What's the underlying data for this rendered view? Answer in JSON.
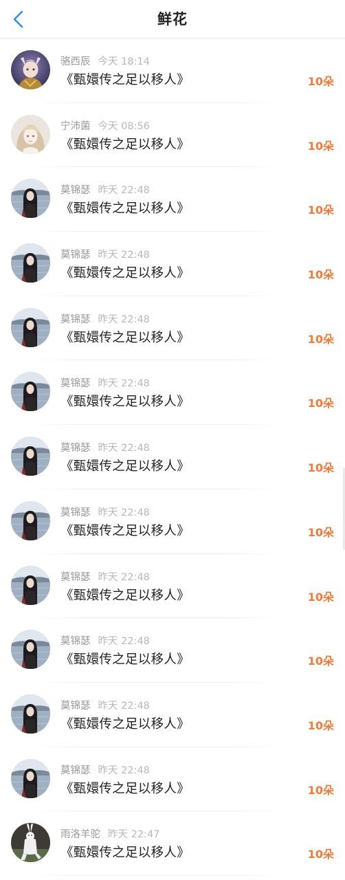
{
  "header": {
    "title": "鲜花",
    "back_icon": "chevron-left-icon",
    "accent_color": "#2b8ef0"
  },
  "colors": {
    "amount": "#f07c3b",
    "name": "#999999",
    "time": "#b8b8b8",
    "book": "#222222"
  },
  "items": [
    {
      "name": "骆西辰",
      "time": "今天 18:14",
      "book": "《甄嬛传之足以移人》",
      "amount": "10朵",
      "avatar": "anime-warrior-avatar"
    },
    {
      "name": "宁沛菌",
      "time": "今天 08:56",
      "book": "《甄嬛传之足以移人》",
      "amount": "10朵",
      "avatar": "anime-girl-avatar"
    },
    {
      "name": "莫锦瑟",
      "time": "昨天 22:48",
      "book": "《甄嬛传之足以移人》",
      "amount": "10朵",
      "avatar": "lake-girl-avatar"
    },
    {
      "name": "莫锦瑟",
      "time": "昨天 22:48",
      "book": "《甄嬛传之足以移人》",
      "amount": "10朵",
      "avatar": "lake-girl-avatar"
    },
    {
      "name": "莫锦瑟",
      "time": "昨天 22:48",
      "book": "《甄嬛传之足以移人》",
      "amount": "10朵",
      "avatar": "lake-girl-avatar"
    },
    {
      "name": "莫锦瑟",
      "time": "昨天 22:48",
      "book": "《甄嬛传之足以移人》",
      "amount": "10朵",
      "avatar": "lake-girl-avatar"
    },
    {
      "name": "莫锦瑟",
      "time": "昨天 22:48",
      "book": "《甄嬛传之足以移人》",
      "amount": "10朵",
      "avatar": "lake-girl-avatar"
    },
    {
      "name": "莫锦瑟",
      "time": "昨天 22:48",
      "book": "《甄嬛传之足以移人》",
      "amount": "10朵",
      "avatar": "lake-girl-avatar"
    },
    {
      "name": "莫锦瑟",
      "time": "昨天 22:48",
      "book": "《甄嬛传之足以移人》",
      "amount": "10朵",
      "avatar": "lake-girl-avatar"
    },
    {
      "name": "莫锦瑟",
      "time": "昨天 22:48",
      "book": "《甄嬛传之足以移人》",
      "amount": "10朵",
      "avatar": "lake-girl-avatar"
    },
    {
      "name": "莫锦瑟",
      "time": "昨天 22:48",
      "book": "《甄嬛传之足以移人》",
      "amount": "10朵",
      "avatar": "lake-girl-avatar"
    },
    {
      "name": "莫锦瑟",
      "time": "昨天 22:48",
      "book": "《甄嬛传之足以移人》",
      "amount": "10朵",
      "avatar": "lake-girl-avatar"
    },
    {
      "name": "雨洛羊驼",
      "time": "昨天 22:47",
      "book": "《甄嬛传之足以移人》",
      "amount": "10朵",
      "avatar": "white-rabbit-avatar"
    }
  ]
}
